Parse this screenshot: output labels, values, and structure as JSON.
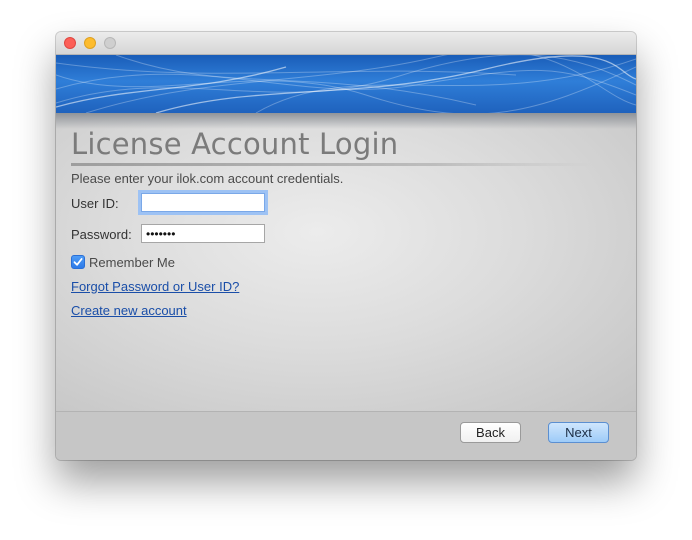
{
  "window": {
    "controls": [
      "close",
      "minimize",
      "zoom"
    ]
  },
  "header": {
    "title": "License Account Login",
    "subtitle": "Please enter your ilok.com account credentials."
  },
  "form": {
    "user_id_label": "User ID:",
    "user_id_value": "",
    "password_label": "Password:",
    "password_value": "•••••••",
    "remember_label": "Remember Me",
    "remember_checked": true
  },
  "links": {
    "forgot": "Forgot Password or User ID?",
    "create": "Create new account"
  },
  "footer": {
    "back_label": "Back",
    "next_label": "Next"
  },
  "colors": {
    "banner": "#2f7ed8",
    "link": "#1a4ea8",
    "default_button": "#9dcbf8",
    "focus_ring": "#9dc2f4"
  }
}
